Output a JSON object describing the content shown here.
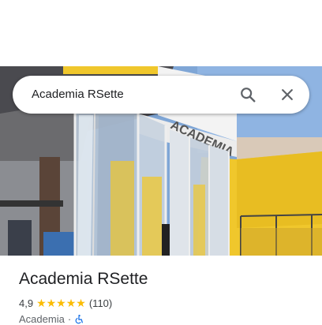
{
  "search": {
    "query": "Academia RSette"
  },
  "place": {
    "name": "Academia RSette",
    "rating": "4,9",
    "stars": "★★★★★",
    "reviews": "(110)",
    "category": "Academia",
    "separator": "·"
  },
  "colors": {
    "stars": "#fbbc04",
    "accessibility": "#1a73e8",
    "wall": "#f0c72c"
  },
  "icons": [
    "search-icon",
    "close-icon",
    "wheelchair-icon"
  ]
}
